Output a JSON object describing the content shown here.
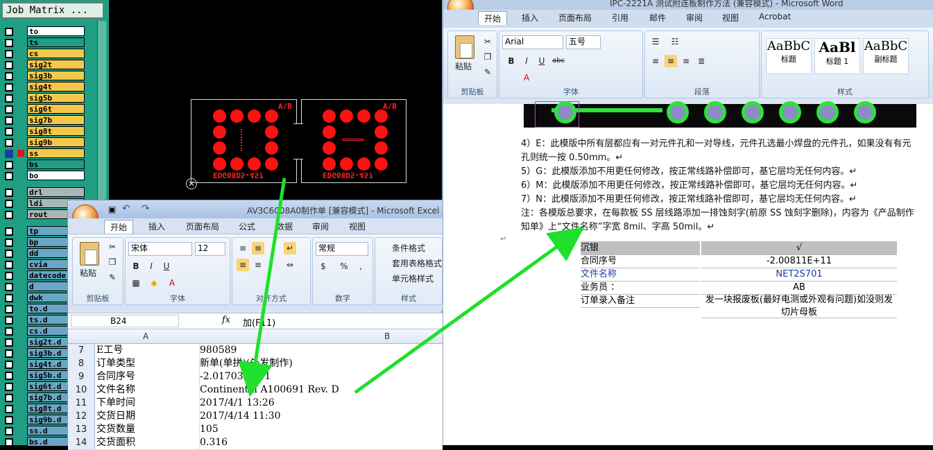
{
  "job_matrix": {
    "title": "Job Matrix ...",
    "layers_top": [
      {
        "name": "to",
        "color": "#ffffff"
      },
      {
        "name": "ts",
        "color": "#1f9e84"
      },
      {
        "name": "cs",
        "color": "#f5c74a"
      },
      {
        "name": "sig2t",
        "color": "#f5c74a"
      },
      {
        "name": "sig3b",
        "color": "#f5c74a"
      },
      {
        "name": "sig4t",
        "color": "#f5c74a"
      },
      {
        "name": "sig5b",
        "color": "#f5c74a"
      },
      {
        "name": "sig6t",
        "color": "#f5c74a"
      },
      {
        "name": "sig7b",
        "color": "#f5c74a"
      },
      {
        "name": "sig8t",
        "color": "#f5c74a"
      },
      {
        "name": "sig9b",
        "color": "#f5c74a"
      },
      {
        "name": "ss",
        "color": "#f5c74a",
        "selected": true,
        "mark": true
      },
      {
        "name": "bs",
        "color": "#1f9e84"
      },
      {
        "name": "bo",
        "color": "#ffffff"
      }
    ],
    "layers_drill": [
      {
        "name": "drl",
        "color": "#a8b8b6"
      },
      {
        "name": "ldi",
        "color": "#a8b8b6"
      },
      {
        "name": "rout",
        "color": "#a8b8b6"
      }
    ],
    "layers_misc": [
      {
        "name": "tp",
        "color": "#6aa6c6"
      },
      {
        "name": "bp",
        "color": "#6aa6c6"
      },
      {
        "name": "dd",
        "color": "#6aa6c6"
      },
      {
        "name": "cvia",
        "color": "#6aa6c6"
      },
      {
        "name": "datecode",
        "color": "#6aa6c6"
      },
      {
        "name": "d",
        "color": "#6aa6c6"
      },
      {
        "name": "dwk",
        "color": "#6aa6c6"
      },
      {
        "name": "to.d",
        "color": "#6aa6c6"
      },
      {
        "name": "ts.d",
        "color": "#6aa6c6"
      },
      {
        "name": "cs.d",
        "color": "#6aa6c6"
      },
      {
        "name": "sig2t.d",
        "color": "#6aa6c6"
      },
      {
        "name": "sig3b.d",
        "color": "#6aa6c6"
      },
      {
        "name": "sig4t.d",
        "color": "#6aa6c6"
      },
      {
        "name": "sig5b.d",
        "color": "#6aa6c6"
      },
      {
        "name": "sig6t.d",
        "color": "#6aa6c6"
      },
      {
        "name": "sig7b.d",
        "color": "#6aa6c6"
      },
      {
        "name": "sig8t.d",
        "color": "#6aa6c6"
      },
      {
        "name": "sig9b.d",
        "color": "#6aa6c6"
      },
      {
        "name": "ss.d",
        "color": "#6aa6c6"
      },
      {
        "name": "bs.d",
        "color": "#6aa6c6"
      }
    ]
  },
  "cam": {
    "label_left": "A/B",
    "label_right": "A/B",
    "bottom_text_left": "EDG08D5-457",
    "bottom_text_right": "EDG08D5-457"
  },
  "excel": {
    "title": "AV3C6008A0制作单 [兼容模式] - Microsoft Excel",
    "tabs": [
      "开始",
      "插入",
      "页面布局",
      "公式",
      "数据",
      "审阅",
      "视图"
    ],
    "active_tab": "开始",
    "clipboard": {
      "paste": "粘贴",
      "group": "剪贴板"
    },
    "font": {
      "name": "宋体",
      "size": "12",
      "group": "字体"
    },
    "alignment_group": "对齐方式",
    "number": {
      "format": "常规",
      "group": "数字"
    },
    "styles": {
      "conditional": "条件格式",
      "table": "套用表格格式",
      "cell": "单元格样式",
      "group": "样式"
    },
    "name_box": "B24",
    "fx": "fx",
    "formula": "加(F11)",
    "columns": [
      "A",
      "B"
    ],
    "rows": [
      {
        "n": "7",
        "a": "E工号",
        "b": "980589"
      },
      {
        "n": "8",
        "a": "订单类型",
        "b": "新单(单拼)(外发制作)"
      },
      {
        "n": "9",
        "a": "合同序号",
        "b": "-2.01703E+11"
      },
      {
        "n": "10",
        "a": "文件名称",
        "b": "Continental A100691 Rev. D"
      },
      {
        "n": "11",
        "a": "下单时间",
        "b": "2017/4/1 13:26"
      },
      {
        "n": "12",
        "a": "交货日期",
        "b": "2017/4/14 11:30"
      },
      {
        "n": "13",
        "a": "交货数量",
        "b": "105"
      },
      {
        "n": "14",
        "a": "交货面积",
        "b": "0.316"
      }
    ]
  },
  "word": {
    "title": "IPC-2221A 测试附连板制作方法 (兼容模式) - Microsoft Word",
    "tabs": [
      "开始",
      "插入",
      "页面布局",
      "引用",
      "邮件",
      "审阅",
      "视图",
      "Acrobat"
    ],
    "active_tab": "开始",
    "clipboard": {
      "paste": "粘贴",
      "group": "剪贴板"
    },
    "font": {
      "name": "Arial",
      "size": "五号",
      "group": "字体"
    },
    "paragraph_group": "段落",
    "styles": [
      {
        "preview": "AaBbC",
        "name": "标题"
      },
      {
        "preview": "AaBl",
        "name": "标题 1"
      },
      {
        "preview": "AaBbC",
        "name": "副标题"
      }
    ],
    "styles_group": "样式",
    "lines": [
      "4）E：此模版中所有层都应有一对元件孔和一对导线，元件孔选最小焊盘的元件孔，如果没有有元",
      "    孔则统一按 0.50mm。↵",
      "5）G：此模版添加不用更任何修改，按正常线路补偿即可，基它层均无任何内容。↵",
      "6）M：此模版添加不用更任何修改，按正常线路补偿即可，基它层均无任何内容。↵",
      "7）N：此模版添加不用更任何修改，按正常线路补偿即可，基它层均无任何内容。↵",
      "注：各模版总要求，在每款板 SS 层线路添加一排蚀刻字(前原 SS 蚀刻字删除)，内容为《产品制作",
      "    知单》上“文件名称”字宽 8mil、字高 50mil。↵"
    ],
    "table": [
      {
        "k": "沉银",
        "v": "√"
      },
      {
        "k": "合同序号",
        "v": "-2.00811E+11"
      },
      {
        "k": "文件名称",
        "v": "NET2S701"
      },
      {
        "k": "业务员 ：",
        "v": "AB"
      },
      {
        "k": "订单录入备注",
        "v": "发一块报废板(最好电测或外观有问题)如没则发切片母板"
      }
    ]
  }
}
